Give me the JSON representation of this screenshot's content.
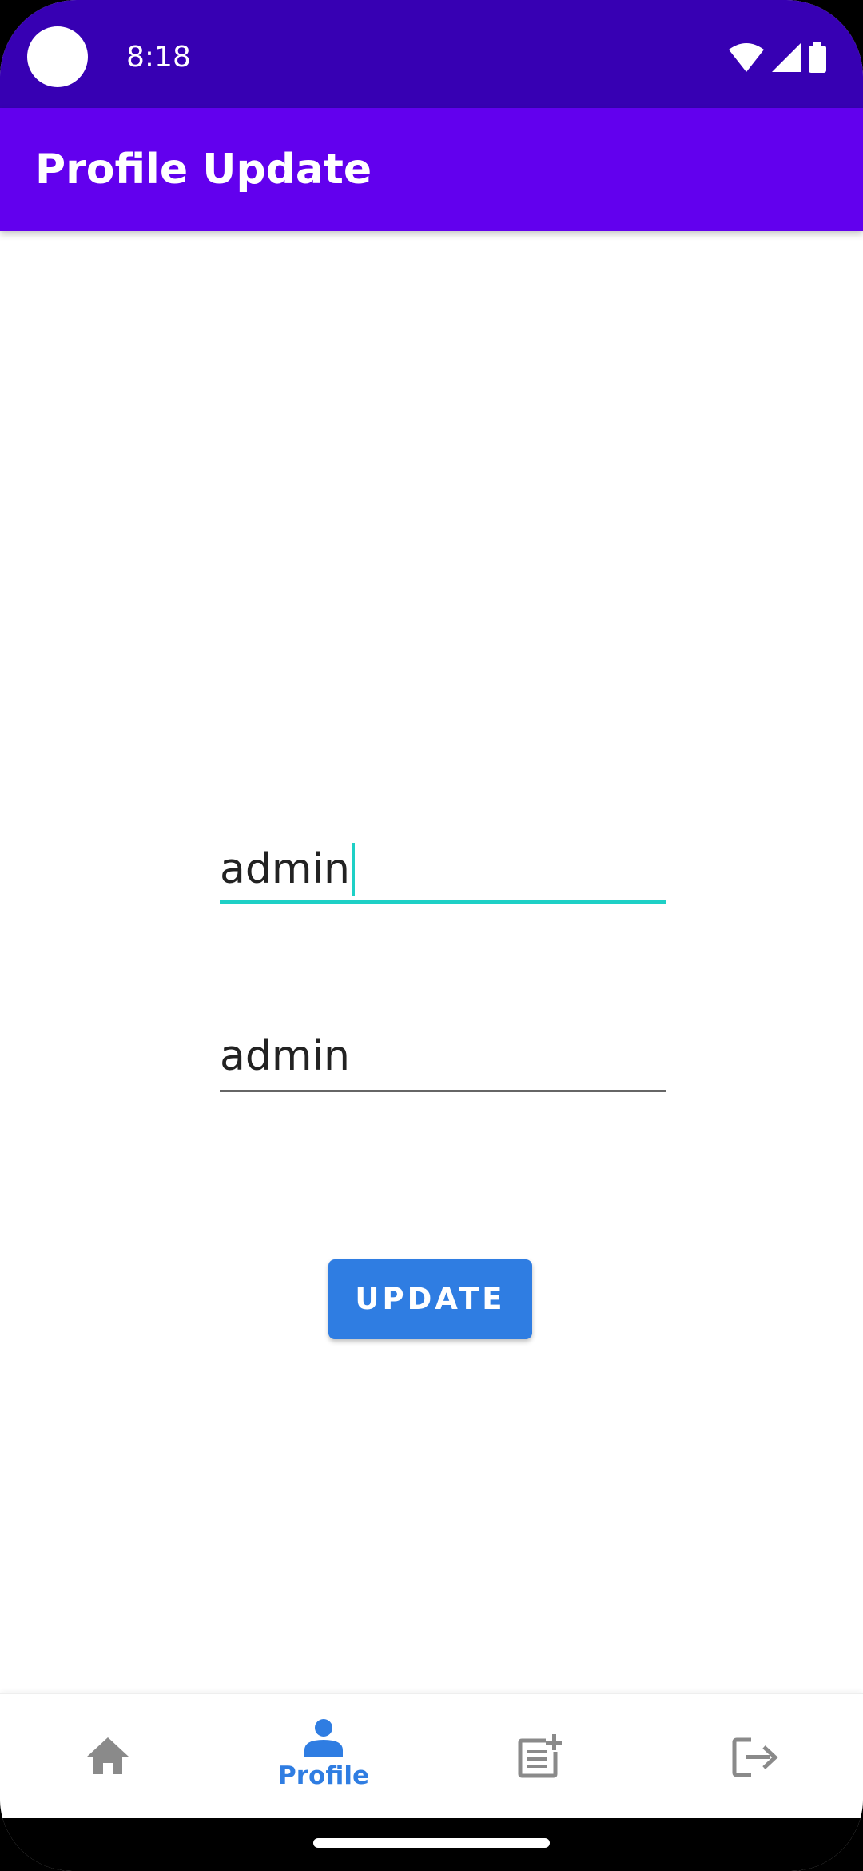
{
  "status_bar": {
    "time": "8:18",
    "icons": [
      "wifi-icon",
      "signal-icon",
      "battery-icon"
    ]
  },
  "app_bar": {
    "title": "Profile Update"
  },
  "form": {
    "username_value": "admin",
    "password_value": "admin",
    "update_label": "UPDATE"
  },
  "bottom_nav": {
    "items": [
      {
        "icon": "home-icon",
        "label": "",
        "active": false
      },
      {
        "icon": "person-icon",
        "label": "Profile",
        "active": true
      },
      {
        "icon": "post-add-icon",
        "label": "",
        "active": false
      },
      {
        "icon": "logout-icon",
        "label": "",
        "active": false
      }
    ]
  },
  "colors": {
    "status_bar": "#3700b3",
    "app_bar": "#6200ee",
    "accent": "#1ed0c6",
    "button": "#2f7de2",
    "nav_active": "#2f7de2",
    "nav_inactive": "#8a8a8a"
  }
}
